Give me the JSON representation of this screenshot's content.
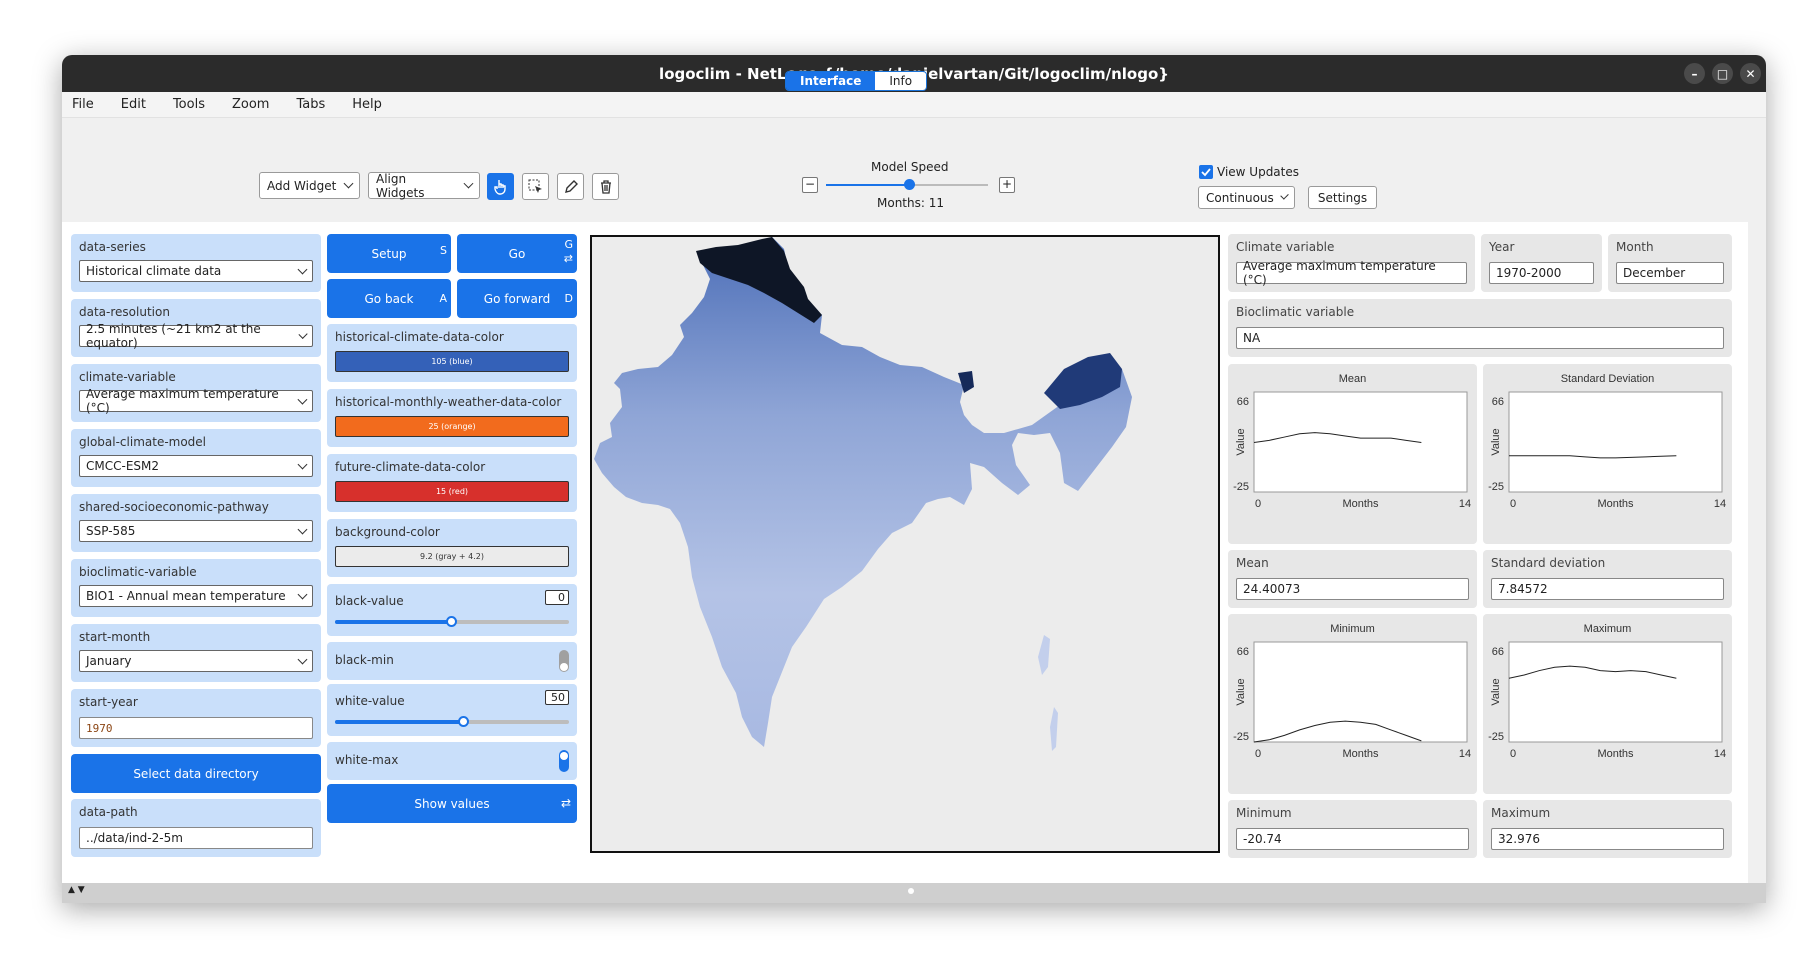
{
  "window": {
    "title": "logoclim - NetLogo {/home/danielvartan/Git/logoclim/nlogo}"
  },
  "menu": [
    "File",
    "Edit",
    "Tools",
    "Zoom",
    "Tabs",
    "Help"
  ],
  "tabs": [
    {
      "label": "Interface",
      "active": true
    },
    {
      "label": "Info",
      "active": false
    }
  ],
  "toolbar": {
    "add_widget": "Add Widget",
    "align_widgets": "Align Widgets",
    "model_speed_label": "Model Speed",
    "months_label": "Months: 11",
    "view_updates_label": "View Updates",
    "update_mode": "Continuous",
    "settings_label": "Settings"
  },
  "left": {
    "choosers": [
      {
        "label": "data-series",
        "value": "Historical climate data"
      },
      {
        "label": "data-resolution",
        "value": "2.5 minutes (~21 km2 at the equator)"
      },
      {
        "label": "climate-variable",
        "value": "Average maximum temperature (°C)"
      },
      {
        "label": "global-climate-model",
        "value": "CMCC-ESM2"
      },
      {
        "label": "shared-socioeconomic-pathway",
        "value": "SSP-585"
      },
      {
        "label": "bioclimatic-variable",
        "value": "BIO1 - Annual mean temperature"
      },
      {
        "label": "start-month",
        "value": "January"
      }
    ],
    "start_year": {
      "label": "start-year",
      "value": "1970"
    },
    "select_dir": "Select data directory",
    "data_path": {
      "label": "data-path",
      "value": "../data/ind-2-5m"
    }
  },
  "mid": {
    "setup": {
      "label": "Setup",
      "key": "S"
    },
    "go": {
      "label": "Go",
      "key": "G"
    },
    "go_back": {
      "label": "Go back",
      "key": "A"
    },
    "go_forward": {
      "label": "Go forward",
      "key": "D"
    },
    "colors": [
      {
        "label": "historical-climate-data-color",
        "value": "105 (blue)",
        "color": "#3461b8",
        "text": "#ffffff"
      },
      {
        "label": "historical-monthly-weather-data-color",
        "value": "25 (orange)",
        "color": "#f26b1d",
        "text": "#ffffff"
      },
      {
        "label": "future-climate-data-color",
        "value": "15 (red)",
        "color": "#d7302c",
        "text": "#ffffff"
      },
      {
        "label": "background-color",
        "value": "9.2 (gray + 4.2)",
        "color": "#ebebeb",
        "text": "#333333"
      }
    ],
    "black_value": {
      "label": "black-value",
      "value": "0",
      "fraction": 0.5
    },
    "black_min": {
      "label": "black-min",
      "on": false
    },
    "white_value": {
      "label": "white-value",
      "value": "50",
      "fraction": 0.55
    },
    "white_max": {
      "label": "white-max",
      "on": true
    },
    "show_values": "Show values"
  },
  "right": {
    "climate_variable": {
      "label": "Climate variable",
      "value": "Average maximum temperature (°C)"
    },
    "year": {
      "label": "Year",
      "value": "1970-2000"
    },
    "month": {
      "label": "Month",
      "value": "December"
    },
    "bioclimatic_variable": {
      "label": "Bioclimatic variable",
      "value": "NA"
    },
    "mean": {
      "label": "Mean",
      "value": "24.40073"
    },
    "std": {
      "label": "Standard deviation",
      "value": "7.84572"
    },
    "minimum": {
      "label": "Minimum",
      "value": "-20.74"
    },
    "maximum": {
      "label": "Maximum",
      "value": "32.976"
    }
  },
  "chart_data": [
    {
      "type": "line",
      "title": "Mean",
      "xlabel": "Months",
      "ylabel": "Value",
      "xlim": [
        0,
        14
      ],
      "ylim": [
        -25,
        66
      ],
      "x": [
        0,
        1,
        2,
        3,
        4,
        5,
        6,
        7,
        8,
        9,
        10,
        11
      ],
      "y": [
        20,
        22,
        25,
        28,
        29,
        28,
        26,
        24,
        24,
        24,
        22,
        20
      ]
    },
    {
      "type": "line",
      "title": "Standard Deviation",
      "xlabel": "Months",
      "ylabel": "Value",
      "xlim": [
        0,
        14
      ],
      "ylim": [
        -25,
        66
      ],
      "x": [
        0,
        1,
        2,
        3,
        4,
        5,
        6,
        7,
        8,
        9,
        10,
        11
      ],
      "y": [
        8,
        8,
        8,
        8,
        8,
        7,
        6,
        6,
        6.5,
        7,
        7.5,
        8
      ]
    },
    {
      "type": "line",
      "title": "Minimum",
      "xlabel": "Months",
      "ylabel": "Value",
      "xlim": [
        0,
        14
      ],
      "ylim": [
        -25,
        66
      ],
      "x": [
        0,
        1,
        2,
        3,
        4,
        5,
        6,
        7,
        8,
        9,
        10,
        11
      ],
      "y": [
        -25,
        -23,
        -19,
        -14,
        -10,
        -7,
        -6,
        -7,
        -9,
        -14,
        -19,
        -24
      ]
    },
    {
      "type": "line",
      "title": "Maximum",
      "xlabel": "Months",
      "ylabel": "Value",
      "xlim": [
        0,
        14
      ],
      "ylim": [
        -25,
        66
      ],
      "x": [
        0,
        1,
        2,
        3,
        4,
        5,
        6,
        7,
        8,
        9,
        10,
        11
      ],
      "y": [
        33,
        36,
        40,
        43,
        44,
        43,
        40,
        39,
        40,
        39,
        36,
        33
      ]
    }
  ]
}
